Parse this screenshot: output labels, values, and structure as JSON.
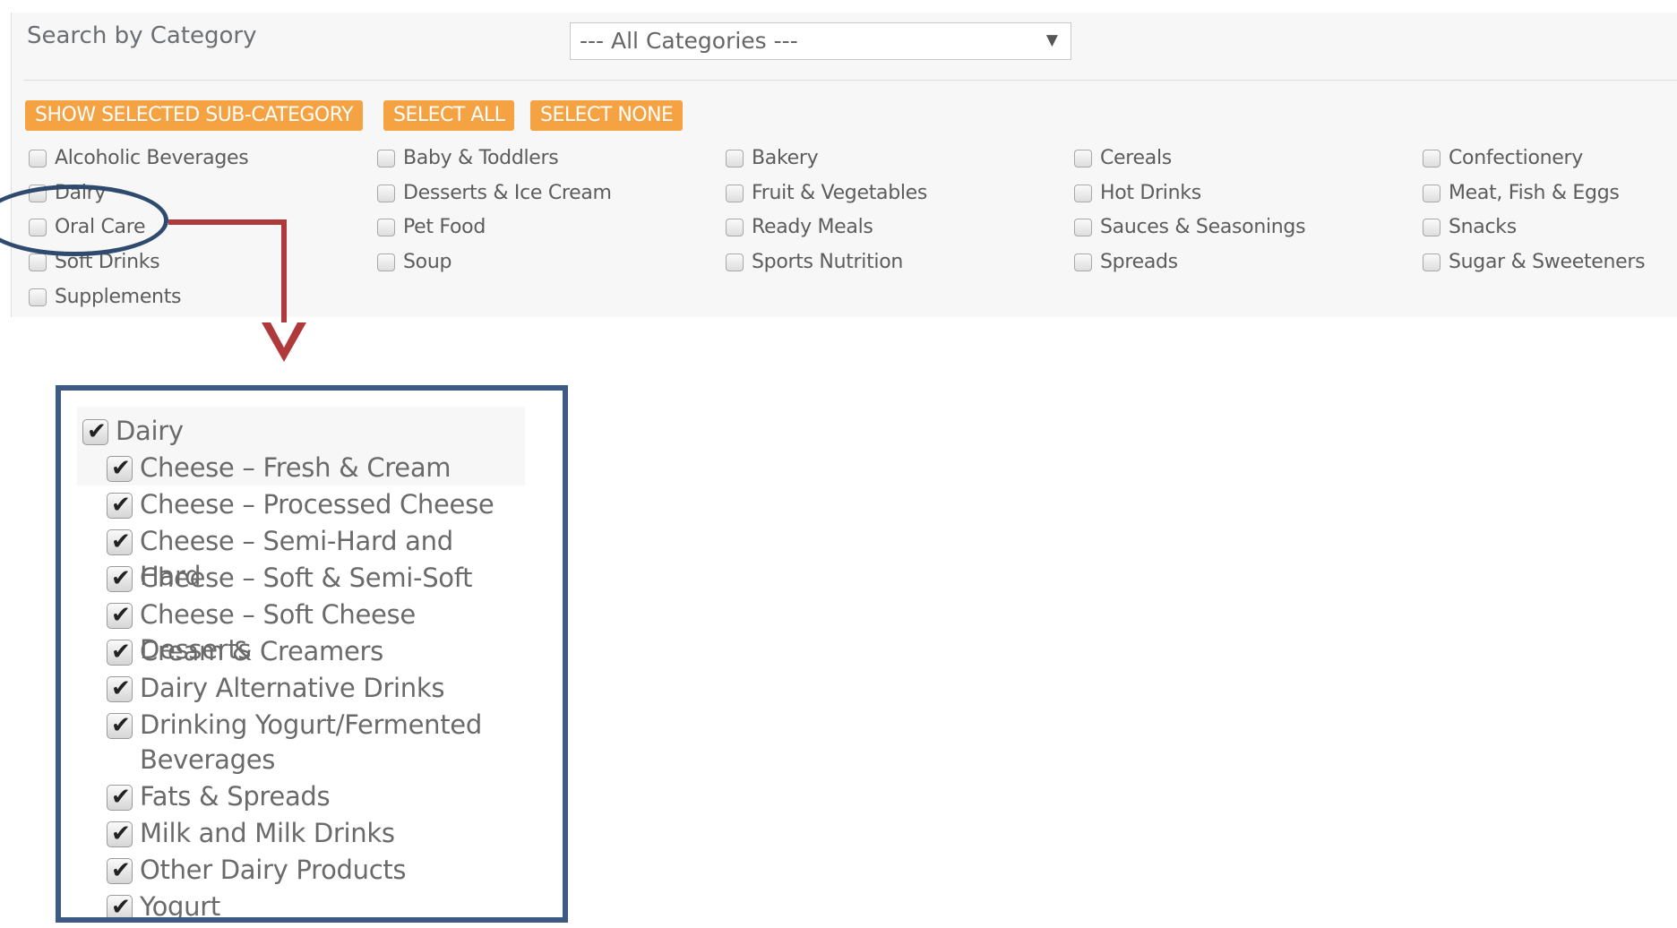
{
  "search": {
    "label": "Search by Category",
    "select_value": "--- All Categories ---"
  },
  "buttons": {
    "show_selected": "SHOW SELECTED SUB-CATEGORY",
    "select_all": "SELECT ALL",
    "select_none": "SELECT NONE"
  },
  "categories": [
    "Alcoholic Beverages",
    "Baby & Toddlers",
    "Bakery",
    "Cereals",
    "Confectionery",
    "Dairy",
    "Desserts & Ice Cream",
    "Fruit & Vegetables",
    "Hot Drinks",
    "Meat, Fish & Eggs",
    "Oral Care",
    "Pet Food",
    "Ready Meals",
    "Sauces & Seasonings",
    "Snacks",
    "Soft Drinks",
    "Soup",
    "Sports Nutrition",
    "Spreads",
    "Sugar & Sweeteners",
    "Supplements"
  ],
  "dairy": {
    "parent": "Dairy",
    "children": [
      "Cheese – Fresh & Cream",
      "Cheese – Processed Cheese",
      "Cheese – Semi-Hard and Hard",
      "Cheese – Soft & Semi-Soft",
      "Cheese – Soft Cheese Desserts",
      "Cream & Creamers",
      "Dairy Alternative Drinks",
      "Drinking Yogurt/Fermented Beverages",
      "Fats & Spreads",
      "Milk and Milk Drinks",
      "Other Dairy Products",
      "Yogurt"
    ]
  },
  "colors": {
    "button": "#f5a242",
    "highlight": "#3c5a84",
    "arrow": "#b0393b"
  }
}
